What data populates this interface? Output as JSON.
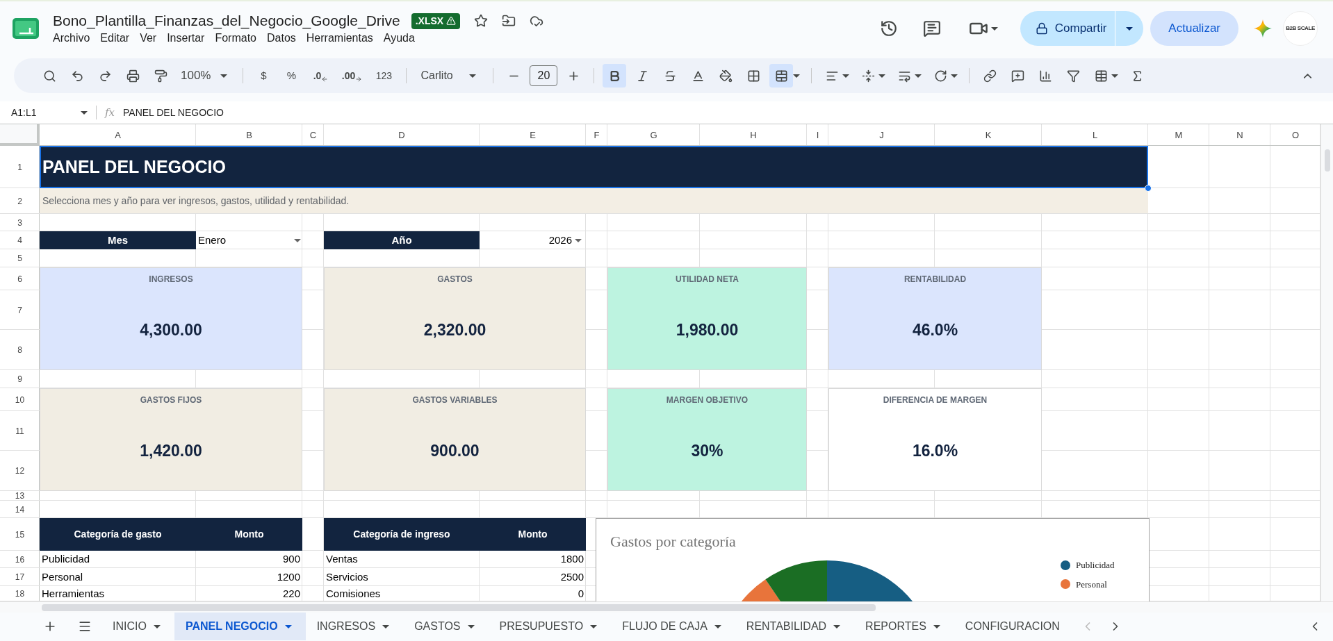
{
  "document": {
    "title": "Bono_Plantilla_Finanzas_del_Negocio_Google_Drive",
    "badge": ".XLSX"
  },
  "menu": [
    "Archivo",
    "Editar",
    "Ver",
    "Insertar",
    "Formato",
    "Datos",
    "Herramientas",
    "Ayuda"
  ],
  "header_buttons": {
    "share": "Compartir",
    "update": "Actualizar",
    "avatar": "B2B SCALE"
  },
  "toolbar": {
    "zoom": "100%",
    "currency": "$",
    "percent": "%",
    "decrease_decimals": ".0",
    "increase_decimals": ".00",
    "number_format": "123",
    "font": "Carlito",
    "point_field": "20",
    "bold": {
      "selected": true
    },
    "merge": {
      "selected": true
    }
  },
  "formula_bar": {
    "name_box": "A1:L1",
    "fx": "fx",
    "formula": "PANEL DEL NEGOCIO"
  },
  "columns": [
    "A",
    "B",
    "C",
    "D",
    "E",
    "F",
    "G",
    "H",
    "I",
    "J",
    "K",
    "L",
    "M",
    "N",
    "O"
  ],
  "rows": [
    "1",
    "2",
    "3",
    "4",
    "5",
    "6",
    "7",
    "8",
    "9",
    "10",
    "11",
    "12",
    "13",
    "14",
    "15",
    "16",
    "17",
    "18"
  ],
  "sheet": {
    "title": "PANEL DEL NEGOCIO",
    "subtitle": "Selecciona mes y año para ver ingresos, gastos, utilidad y rentabilidad.",
    "month": {
      "label": "Mes",
      "value": "Enero"
    },
    "year": {
      "label": "Año",
      "value": "2026"
    },
    "cards": [
      {
        "label": "INGRESOS",
        "value": "4,300.00",
        "color": "#dbe5fd"
      },
      {
        "label": "GASTOS",
        "value": "2,320.00",
        "color": "#f1ede3"
      },
      {
        "label": "UTILIDAD NETA",
        "value": "1,980.00",
        "color": "#bdf3e0"
      },
      {
        "label": "RENTABILIDAD",
        "value": "46.0%",
        "color": "#dbe5fd"
      },
      {
        "label": "GASTOS FIJOS",
        "value": "1,420.00",
        "color": "#f1ede3"
      },
      {
        "label": "GASTOS VARIABLES",
        "value": "900.00",
        "color": "#f1ede3"
      },
      {
        "label": "MARGEN OBJETIVO",
        "value": "30%",
        "color": "#bdf3e0"
      },
      {
        "label": "DIFERENCIA DE MARGEN",
        "value": "16.0%",
        "color": "#ffffff"
      }
    ],
    "tables": [
      {
        "columns": [
          "Categoría de gasto",
          "Monto"
        ],
        "rows": [
          [
            "Publicidad",
            "900"
          ],
          [
            "Personal",
            "1200"
          ],
          [
            "Herramientas",
            "220"
          ]
        ]
      },
      {
        "columns": [
          "Categoría de ingreso",
          "Monto"
        ],
        "rows": [
          [
            "Ventas",
            "1800"
          ],
          [
            "Servicios",
            "2500"
          ],
          [
            "Comisiones",
            "0"
          ]
        ]
      }
    ],
    "chart": {
      "title": "Gastos por categoría",
      "legend": [
        {
          "label": "Publicidad",
          "color": "#165e83"
        },
        {
          "label": "Personal",
          "color": "#e8743b"
        }
      ]
    }
  },
  "sheet_tabs": [
    {
      "label": "INICIO",
      "selected": false
    },
    {
      "label": "PANEL NEGOCIO",
      "selected": true
    },
    {
      "label": "INGRESOS",
      "selected": false
    },
    {
      "label": "GASTOS",
      "selected": false
    },
    {
      "label": "PRESUPUESTO",
      "selected": false
    },
    {
      "label": "FLUJO DE CAJA",
      "selected": false
    },
    {
      "label": "RENTABILIDAD",
      "selected": false
    },
    {
      "label": "REPORTES",
      "selected": false
    },
    {
      "label": "CONFIGURACION",
      "selected": false
    }
  ]
}
